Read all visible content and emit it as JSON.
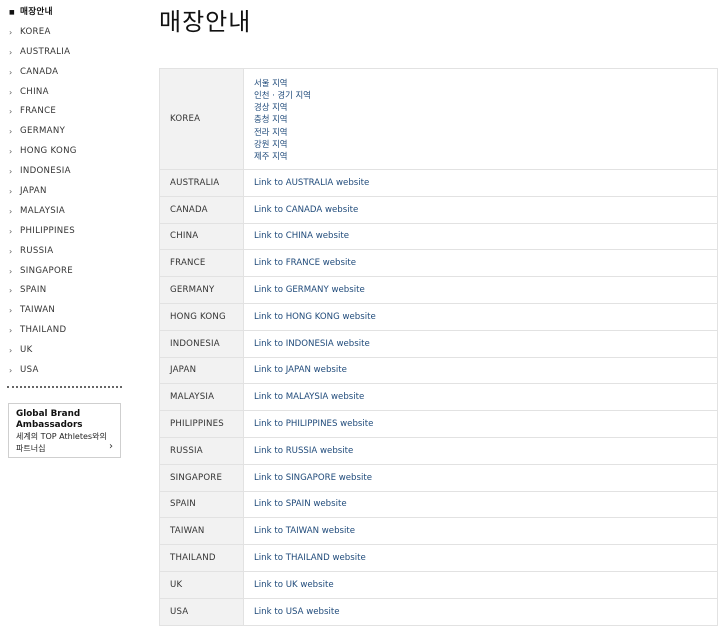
{
  "sidebar": {
    "active": "매장안내",
    "items": [
      "KOREA",
      "AUSTRALIA",
      "CANADA",
      "CHINA",
      "FRANCE",
      "GERMANY",
      "HONG KONG",
      "INDONESIA",
      "JAPAN",
      "MALAYSIA",
      "PHILIPPINES",
      "RUSSIA",
      "SINGAPORE",
      "SPAIN",
      "TAIWAN",
      "THAILAND",
      "UK",
      "USA"
    ],
    "ambassador": {
      "line1": "Global Brand",
      "line2": "Ambassadors",
      "line3": "세계의 TOP Athletes와의",
      "line4": "파트너십"
    }
  },
  "page": {
    "title": "매장안내"
  },
  "table": {
    "korea": {
      "label": "KOREA",
      "regions": [
        "서울 지역",
        "인천 · 경기 지역",
        "경상 지역",
        "충청 지역",
        "전라 지역",
        "강원 지역",
        "제주 지역"
      ]
    },
    "rows": [
      {
        "country": "AUSTRALIA",
        "link": "Link to AUSTRALIA website"
      },
      {
        "country": "CANADA",
        "link": "Link to CANADA website"
      },
      {
        "country": "CHINA",
        "link": "Link to CHINA website"
      },
      {
        "country": "FRANCE",
        "link": "Link to FRANCE website"
      },
      {
        "country": "GERMANY",
        "link": "Link to GERMANY website"
      },
      {
        "country": "HONG KONG",
        "link": "Link to HONG KONG website"
      },
      {
        "country": "INDONESIA",
        "link": "Link to INDONESIA website"
      },
      {
        "country": "JAPAN",
        "link": "Link to JAPAN website"
      },
      {
        "country": "MALAYSIA",
        "link": "Link to MALAYSIA website"
      },
      {
        "country": "PHILIPPINES",
        "link": "Link to PHILIPPINES website"
      },
      {
        "country": "RUSSIA",
        "link": "Link to RUSSIA website"
      },
      {
        "country": "SINGAPORE",
        "link": "Link to SINGAPORE website"
      },
      {
        "country": "SPAIN",
        "link": "Link to SPAIN website"
      },
      {
        "country": "TAIWAN",
        "link": "Link to TAIWAN website"
      },
      {
        "country": "THAILAND",
        "link": "Link to THAILAND website"
      },
      {
        "country": "UK",
        "link": "Link to UK website"
      },
      {
        "country": "USA",
        "link": "Link to USA website"
      }
    ]
  },
  "colors": {
    "link": "#1f4a7a",
    "header_cell_bg": "#f2f2f2",
    "border": "#e2e2e2"
  },
  "icons": {
    "active_marker": "square-bullet-icon",
    "nav_marker": "chevron-right-icon",
    "ambassador_arrow": "chevron-right-icon"
  }
}
